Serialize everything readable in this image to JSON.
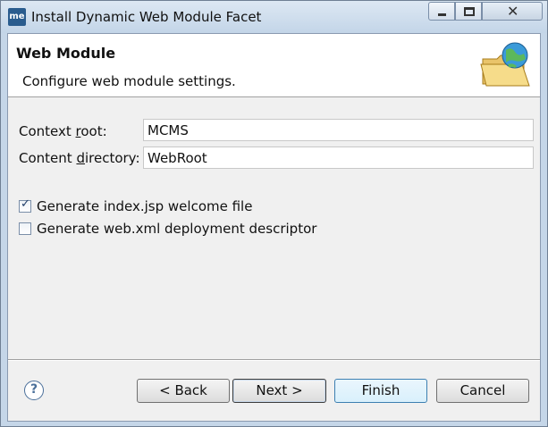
{
  "window": {
    "title": "Install Dynamic Web Module Facet",
    "app_icon_text": "me"
  },
  "banner": {
    "title": "Web Module",
    "description": "Configure web module settings."
  },
  "form": {
    "context_root_label": "Context root:",
    "context_root_value": "MCMS",
    "content_directory_label": "Content directory:",
    "content_directory_value": "WebRoot"
  },
  "options": {
    "generate_index_label": "Generate index.jsp welcome file",
    "generate_index_checked": true,
    "generate_webxml_label": "Generate web.xml deployment descriptor",
    "generate_webxml_checked": false
  },
  "buttons": {
    "back": "< Back",
    "next": "Next >",
    "finish": "Finish",
    "cancel": "Cancel",
    "help": "?"
  }
}
